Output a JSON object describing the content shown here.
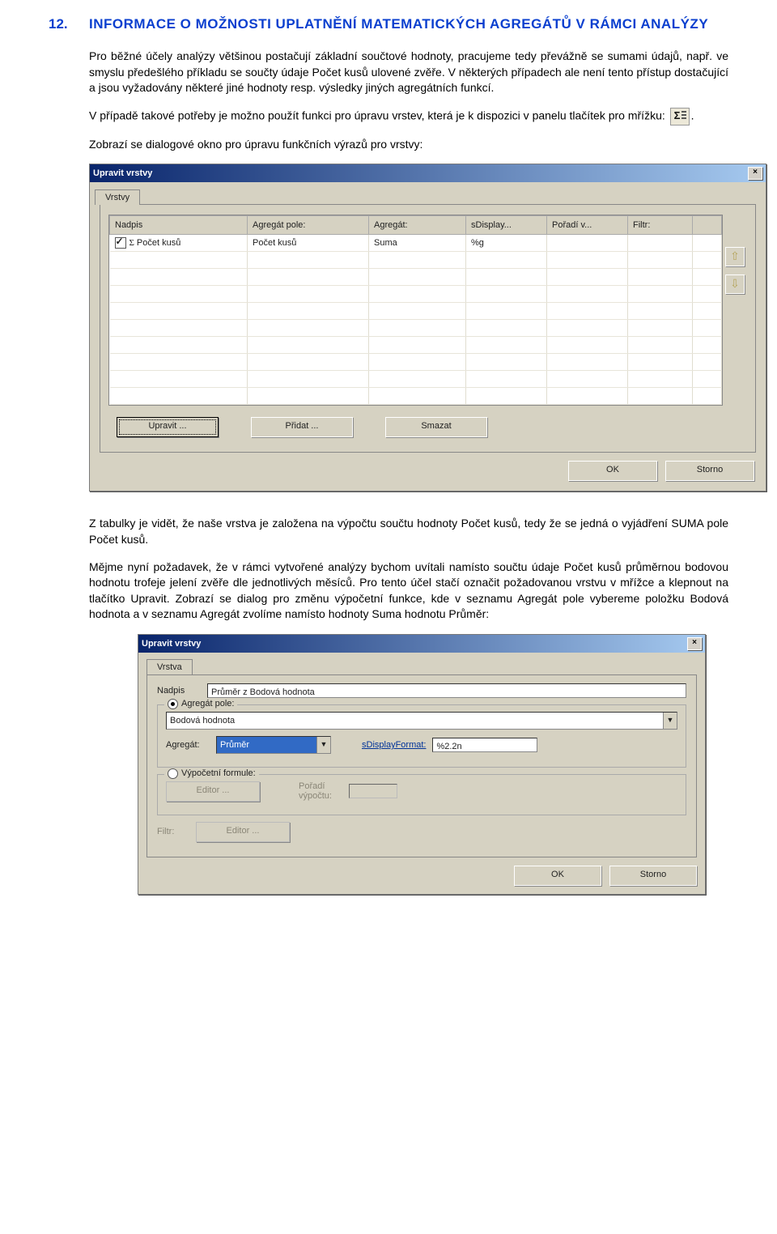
{
  "heading": {
    "number": "12.",
    "title": "INFORMACE O MOŽNOSTI UPLATNĚNÍ MATEMATICKÝCH AGREGÁTŮ V RÁMCI ANALÝZY"
  },
  "para1": "Pro běžné účely analýzy většinou postačují základní součtové hodnoty, pracujeme tedy převážně se sumami údajů, např. ve smyslu předešlého příkladu se součty údaje Počet kusů ulovené zvěře. V některých případech ale není tento přístup dostačující a jsou vyžadovány některé jiné hodnoty resp. výsledky jiných agregátních funkcí.",
  "para2a": "V případě takové potřeby je možno použít funkci pro úpravu vrstev, která je k dispozici v panelu tlačítek pro mřížku: ",
  "para2b": ".",
  "para3": "Zobrazí se dialogové okno pro úpravu funkčních výrazů pro vrstvy:",
  "dialog1": {
    "title": "Upravit vrstvy",
    "tab": "Vrstvy",
    "headers": [
      "Nadpis",
      "Agregát pole:",
      "Agregát:",
      "sDisplay...",
      "Pořadí v...",
      "Filtr:"
    ],
    "row": {
      "nadpis": "Počet kusů",
      "agpole": "Počet kusů",
      "agregat": "Suma",
      "sdisplay": "%g",
      "poradi": "",
      "filtr": ""
    },
    "buttons": {
      "upravit": "Upravit ...",
      "pridat": "Přidat ...",
      "smazat": "Smazat"
    },
    "ok": "OK",
    "storno": "Storno"
  },
  "para4": "Z tabulky je vidět, že naše vrstva je založena na výpočtu součtu hodnoty Počet kusů, tedy že se jedná o vyjádření SUMA pole Počet kusů.",
  "para5": "Mějme nyní požadavek, že v rámci vytvořené analýzy bychom uvítali namísto součtu údaje Počet kusů průměrnou bodovou hodnotu trofeje jelení zvěře dle jednotlivých měsíců. Pro tento účel stačí označit požadovanou vrstvu v mřížce a klepnout na tlačítko Upravit. Zobrazí se dialog pro změnu výpočetní funkce, kde v seznamu Agregát pole vybereme položku Bodová hodnota a v seznamu Agregát zvolíme namísto hodnoty Suma hodnotu Průměr:",
  "dialog2": {
    "title": "Upravit vrstvy",
    "tab": "Vrstva",
    "nadpis_label": "Nadpis",
    "nadpis_value": "Průměr z Bodová hodnota",
    "agpole_label": "Agregát pole:",
    "agpole_value": "Bodová hodnota",
    "agregat_label": "Agregát:",
    "agregat_value": "Průměr",
    "sdf_label": "sDisplayFormat:",
    "sdf_value": "%2.2n",
    "vypf_label": "Výpočetní formule:",
    "editor": "Editor ...",
    "poradi_label": "Pořadí výpočtu:",
    "filtr_label": "Filtr:",
    "ok": "OK",
    "storno": "Storno"
  }
}
